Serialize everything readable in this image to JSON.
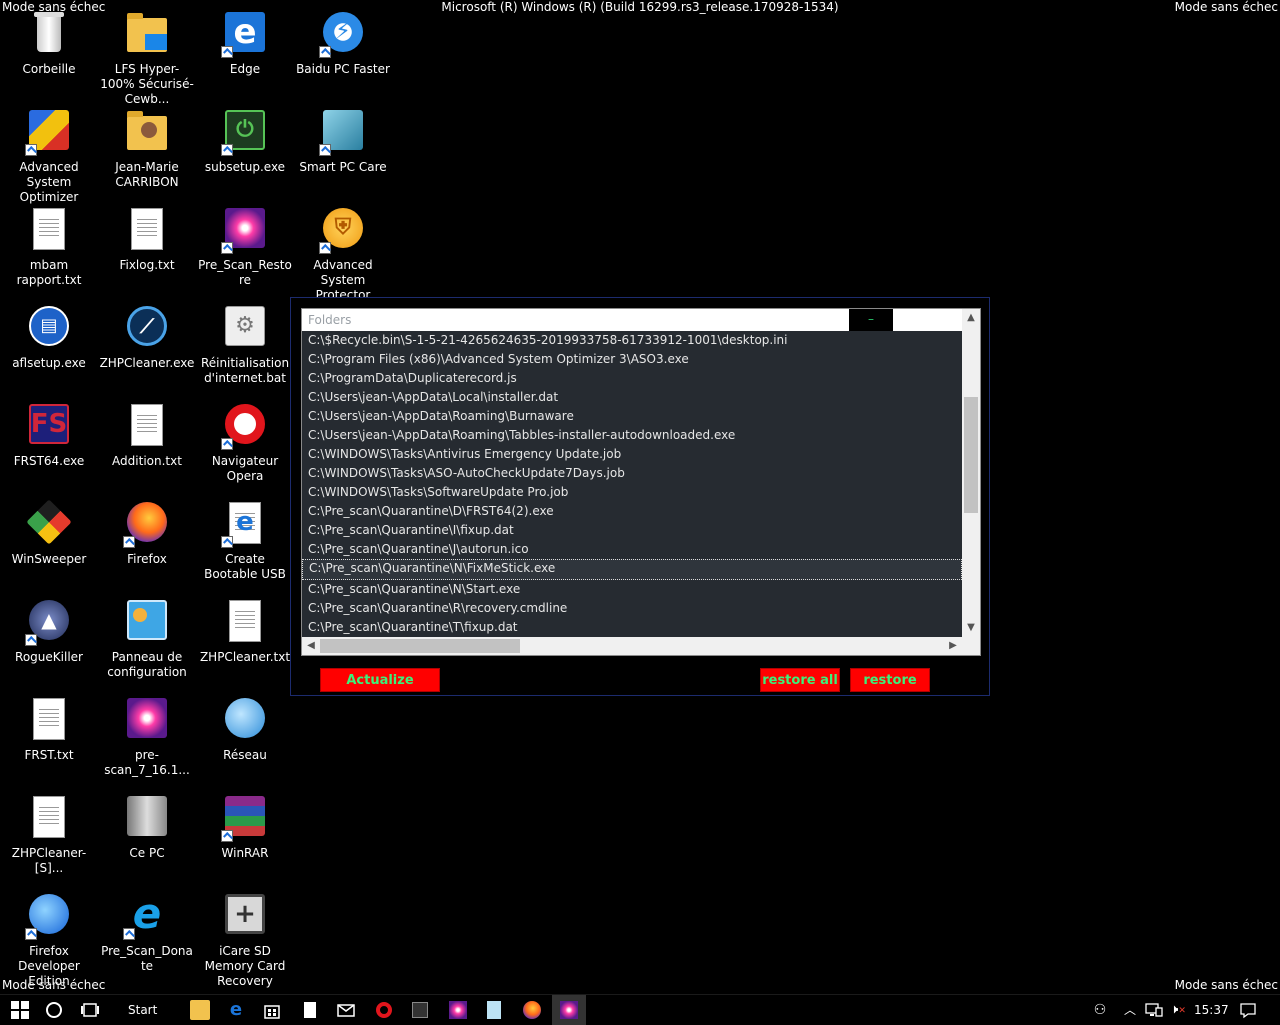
{
  "top_bar": {
    "left": "Mode sans échec",
    "center": "Microsoft (R) Windows (R) (Build 16299.rs3_release.170928-1534)",
    "right": "Mode sans échec"
  },
  "bottom_bar": {
    "left": "Mode sans échec",
    "right": "Mode sans échec"
  },
  "desktop_icons": [
    {
      "label": "Corbeille",
      "icon": "recycle-bin-icon"
    },
    {
      "label": "LFS Hyper-100% Sécurisé-Cewb...",
      "icon": "folder-icon"
    },
    {
      "label": "Edge",
      "icon": "edge-icon"
    },
    {
      "label": "Baidu PC Faster",
      "icon": "baidu-icon"
    },
    {
      "label": "Advanced System Optimizer",
      "icon": "aso-icon"
    },
    {
      "label": "Jean-Marie CARRIBON",
      "icon": "user-folder-icon"
    },
    {
      "label": "subsetup.exe",
      "icon": "installer-icon"
    },
    {
      "label": "Smart PC Care",
      "icon": "smartpccare-icon"
    },
    {
      "label": "mbam rapport.txt",
      "icon": "text-file-icon"
    },
    {
      "label": "Fixlog.txt",
      "icon": "text-file-icon"
    },
    {
      "label": "Pre_Scan_Restore",
      "icon": "prescan-icon"
    },
    {
      "label": "Advanced System Protector",
      "icon": "shield-icon"
    },
    {
      "label": "aflsetup.exe",
      "icon": "afl-installer-icon"
    },
    {
      "label": "ZHPCleaner.exe",
      "icon": "zhp-icon"
    },
    {
      "label": "Réinitialisation d'internet.bat",
      "icon": "batch-file-icon"
    },
    {
      "label": "FRST64.exe",
      "icon": "frst-icon"
    },
    {
      "label": "Addition.txt",
      "icon": "text-file-icon"
    },
    {
      "label": "Navigateur Opera",
      "icon": "opera-icon"
    },
    {
      "label": "WinSweeper",
      "icon": "winsweeper-icon"
    },
    {
      "label": "Firefox",
      "icon": "firefox-icon"
    },
    {
      "label": "Create Bootable USB",
      "icon": "ie-doc-icon"
    },
    {
      "label": "RogueKiller",
      "icon": "roguekiller-icon"
    },
    {
      "label": "Panneau de configuration",
      "icon": "control-panel-icon"
    },
    {
      "label": "ZHPCleaner.txt",
      "icon": "text-file-icon"
    },
    {
      "label": "FRST.txt",
      "icon": "text-file-icon"
    },
    {
      "label": "pre-scan_7_16.1...",
      "icon": "prescan-icon"
    },
    {
      "label": "Réseau",
      "icon": "network-icon"
    },
    {
      "label": "ZHPCleaner-[S]...",
      "icon": "text-file-icon"
    },
    {
      "label": "Ce PC",
      "icon": "computer-icon"
    },
    {
      "label": "WinRAR",
      "icon": "winrar-icon"
    },
    {
      "label": "Firefox Developer Edition",
      "icon": "firefox-dev-icon"
    },
    {
      "label": "Pre_Scan_Donate",
      "icon": "ie-icon"
    },
    {
      "label": "iCare SD Memory Card Recovery",
      "icon": "icare-icon"
    }
  ],
  "restore_window": {
    "list_header": "Folders",
    "header_button": "–",
    "rows": [
      "C:\\$Recycle.bin\\S-1-5-21-4265624635-2019933758-61733912-1001\\desktop.ini",
      "C:\\Program Files (x86)\\Advanced System Optimizer 3\\ASO3.exe",
      "C:\\ProgramData\\Duplicaterecord.js",
      "C:\\Users\\jean-\\AppData\\Local\\installer.dat",
      "C:\\Users\\jean-\\AppData\\Roaming\\Burnaware",
      "C:\\Users\\jean-\\AppData\\Roaming\\Tabbles-installer-autodownloaded.exe",
      "C:\\WINDOWS\\Tasks\\Antivirus Emergency Update.job",
      "C:\\WINDOWS\\Tasks\\ASO-AutoCheckUpdate7Days.job",
      "C:\\WINDOWS\\Tasks\\SoftwareUpdate Pro.job",
      "C:\\Pre_scan\\Quarantine\\D\\FRST64(2).exe",
      "C:\\Pre_scan\\Quarantine\\I\\fixup.dat",
      "C:\\Pre_scan\\Quarantine\\J\\autorun.ico",
      "C:\\Pre_scan\\Quarantine\\N\\FixMeStick.exe",
      "C:\\Pre_scan\\Quarantine\\N\\Start.exe",
      "C:\\Pre_scan\\Quarantine\\R\\recovery.cmdline",
      "C:\\Pre_scan\\Quarantine\\T\\fixup.dat"
    ],
    "selected_index": 12,
    "buttons": {
      "actualize": "Actualize",
      "restore_all": "restore all",
      "restore": "restore"
    }
  },
  "taskbar": {
    "start_label": "Start",
    "time": "15:37"
  }
}
